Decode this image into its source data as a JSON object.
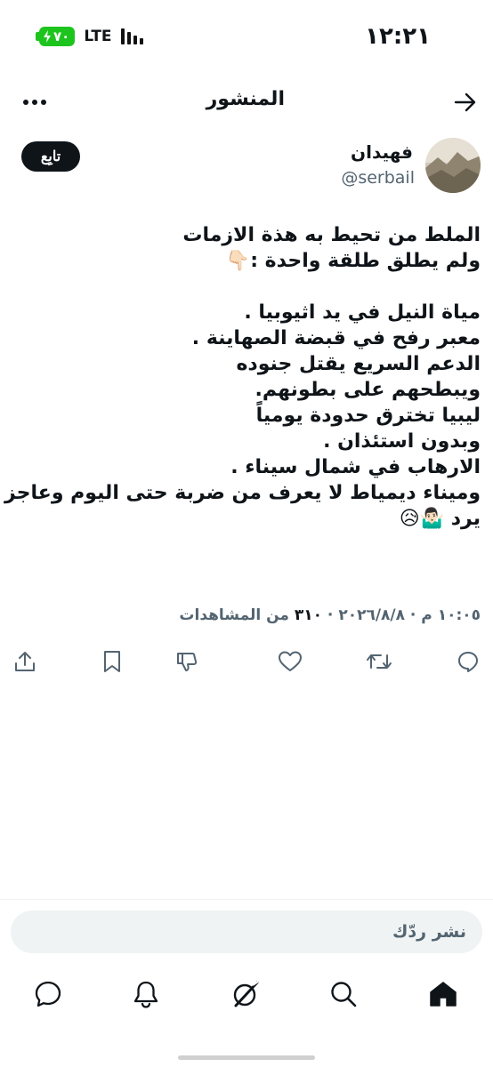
{
  "status_bar": {
    "time": "١٢:٢١",
    "network": "LTE",
    "battery": "٧٠"
  },
  "header": {
    "title": "المنشور"
  },
  "author": {
    "name": "فهيدان",
    "handle": "@serbail",
    "follow_label": "تابِع"
  },
  "post": {
    "lines": [
      "الملط من تحيط به هذة الازمات",
      "ولم يطلق طلقة واحدة :👇🏻",
      "",
      "مياة النيل في يد اثيوبيا .",
      "معبر رفح في قبضة الصهاينة .",
      "الدعم السريع يقتل جنوده",
      "ويبطحهم على بطونهم.",
      "ليبيا تخترق حدودة يومياً",
      "وبدون استئذان .",
      "الارهاب في شمال سيناء .",
      "وميناء ديمياط لا يعرف من ضربة حتى اليوم وعاجز",
      "يرد 🤷🏻‍♂️😥"
    ]
  },
  "meta": {
    "datetime": "١٠:٠٥ م · ٢٠٢٦/٨/٨ · ",
    "views_count": "٣١٠",
    "views_label": " من المشاهدات"
  },
  "actions": [
    "reply-icon",
    "repost-icon",
    "like-icon",
    "dislike-icon",
    "bookmark-icon",
    "share-icon"
  ],
  "reply": {
    "placeholder": "نشر ردّك"
  },
  "bottom_nav": [
    "home-icon",
    "search-icon",
    "grok-icon",
    "notifications-icon",
    "messages-icon"
  ],
  "colors": {
    "text": "#0f1419",
    "secondary": "#536471",
    "battery": "#1ec41e",
    "reply_bg": "#eff3f4"
  }
}
